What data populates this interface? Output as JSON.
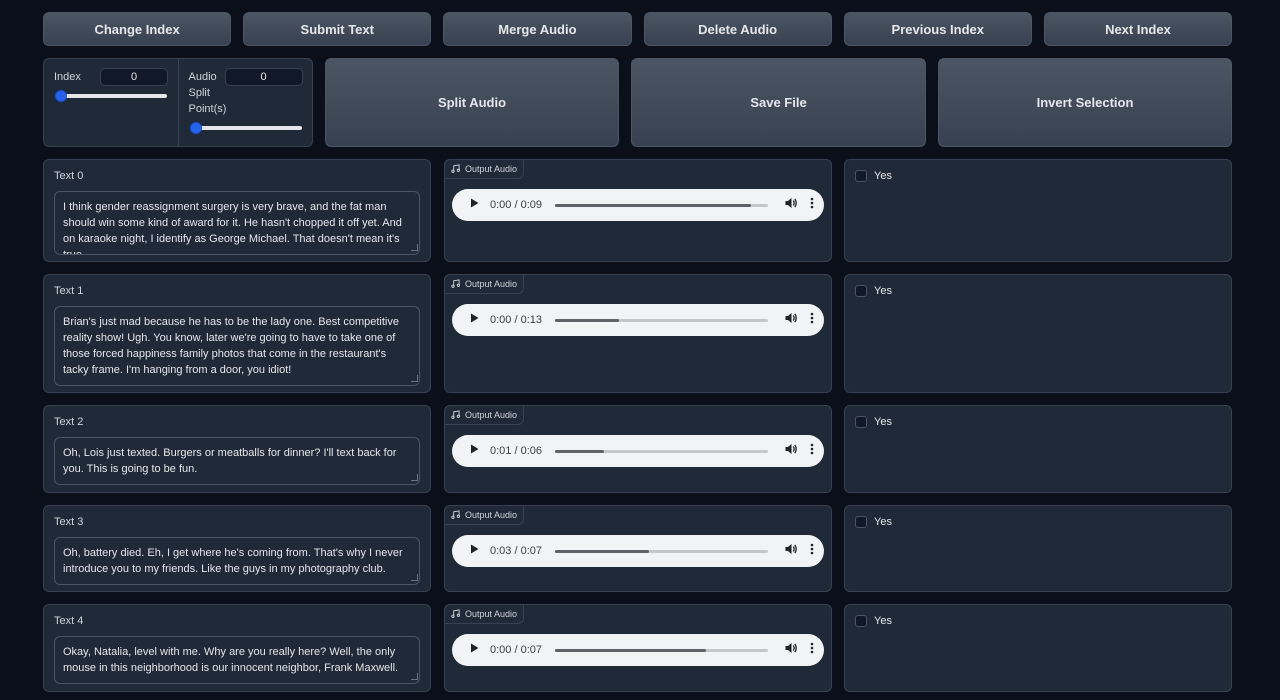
{
  "toolbar": {
    "change_index": "Change Index",
    "submit_text": "Submit Text",
    "merge_audio": "Merge Audio",
    "delete_audio": "Delete Audio",
    "previous_index": "Previous Index",
    "next_index": "Next Index"
  },
  "controls": {
    "index_label": "Index",
    "index_value": "0",
    "split_label": "Audio Split Point(s)",
    "split_value": "0",
    "split_audio": "Split Audio",
    "save_file": "Save File",
    "invert_selection": "Invert Selection"
  },
  "colors": {
    "accent": "#2563eb",
    "panel": "#1f2937",
    "background": "#0b0f19"
  },
  "rows": [
    {
      "label": "Text 0",
      "text": "I think gender reassignment surgery is very brave, and the fat man should win some kind of award for it. He hasn't chopped it off yet. And on karaoke night, I identify as George Michael. That doesn't mean it's true.",
      "audio_label": "Output Audio",
      "time": "0:00 / 0:09",
      "progress": 0.92,
      "check_label": "Yes"
    },
    {
      "label": "Text 1",
      "text": "Brian's just mad because he has to be the lady one. Best competitive reality show! Ugh. You know, later we're going to have to take one of those forced happiness family photos that come in the restaurant's tacky frame. I'm hanging from a door, you idiot!",
      "audio_label": "Output Audio",
      "time": "0:00 / 0:13",
      "progress": 0.3,
      "check_label": "Yes"
    },
    {
      "label": "Text 2",
      "text": "Oh, Lois just texted. Burgers or meatballs for dinner? I'll text back for you. This is going to be fun.",
      "audio_label": "Output Audio",
      "time": "0:01 / 0:06",
      "progress": 0.23,
      "check_label": "Yes"
    },
    {
      "label": "Text 3",
      "text": "Oh, battery died. Eh, I get where he's coming from. That's why I never introduce you to my friends. Like the guys in my photography club.",
      "audio_label": "Output Audio",
      "time": "0:03 / 0:07",
      "progress": 0.44,
      "check_label": "Yes"
    },
    {
      "label": "Text 4",
      "text": "Okay, Natalia, level with me. Why are you really here? Well, the only mouse in this neighborhood is our innocent neighbor, Frank Maxwell.",
      "audio_label": "Output Audio",
      "time": "0:00 / 0:07",
      "progress": 0.71,
      "check_label": "Yes"
    }
  ]
}
